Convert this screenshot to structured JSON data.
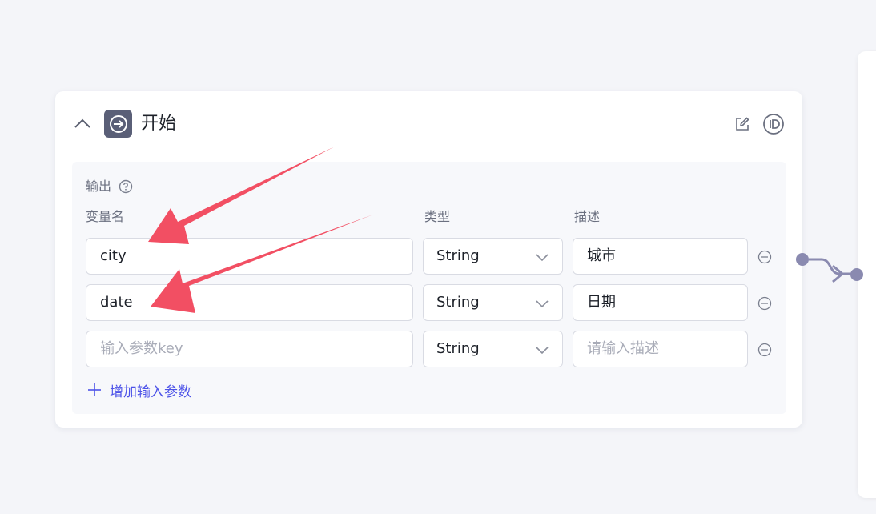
{
  "node": {
    "title": "开始"
  },
  "output": {
    "title": "输出",
    "columns": {
      "name": "变量名",
      "type": "类型",
      "description": "描述"
    },
    "rows": [
      {
        "name": "city",
        "type": "String",
        "description": "城市"
      },
      {
        "name": "date",
        "type": "String",
        "description": "日期"
      }
    ],
    "new_row": {
      "name_placeholder": "输入参数key",
      "type": "String",
      "description_placeholder": "请输入描述"
    },
    "add_label": "增加输入参数"
  },
  "colors": {
    "accent": "#4d53e8",
    "annotation_arrow": "#f24f63",
    "icon_bg": "#5a5f77",
    "connector": "#8a8ab0"
  },
  "icons": [
    "chevron-up-icon",
    "start-node-icon",
    "edit-icon",
    "id-icon",
    "help-icon",
    "chevron-down-icon",
    "remove-circle-icon",
    "plus-icon",
    "connector-handle-icon"
  ]
}
